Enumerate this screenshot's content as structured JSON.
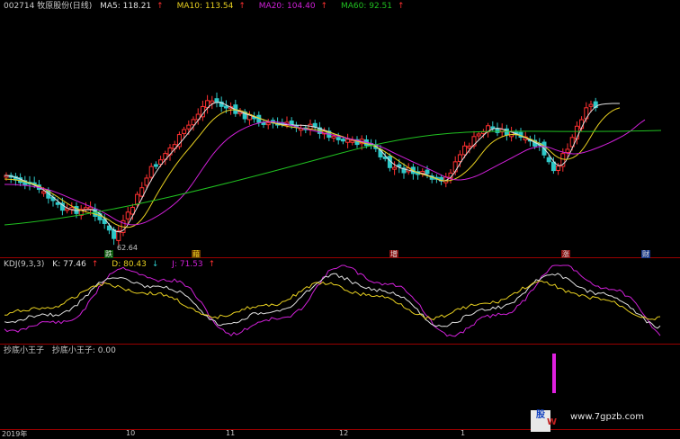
{
  "main": {
    "symbol": "002714 牧原股份(日线)",
    "ma5": {
      "label": "MA5: 118.21",
      "arrow": "↑"
    },
    "ma10": {
      "label": "MA10: 113.54",
      "arrow": "↑"
    },
    "ma20": {
      "label": "MA20: 104.40",
      "arrow": "↑"
    },
    "ma60": {
      "label": "MA60: 92.51",
      "arrow": "↑"
    },
    "low_mark": "62.64",
    "tags": [
      "跌",
      "藉",
      "增",
      "涨",
      "财"
    ]
  },
  "kdj": {
    "name": "KDJ(9,3,3)",
    "k": {
      "label": "K: 77.46",
      "arrow": "↑"
    },
    "d": {
      "label": "D: 80.43",
      "arrow": "↓"
    },
    "j": {
      "label": "J: 71.53",
      "arrow": "↑"
    }
  },
  "signal": {
    "name": "抄底小王子",
    "value": "抄底小王子: 0.00"
  },
  "time_axis": [
    "2019年",
    "10",
    "11",
    "12",
    "1"
  ],
  "watermark": {
    "logo": "股",
    "w": "W",
    "url": "www.7gpzb.com"
  },
  "colors": {
    "up": "#ff3030",
    "down": "#2ec8c8",
    "ma5": "#e0e0e0",
    "ma10": "#e8d020",
    "ma20": "#d020d8",
    "ma60": "#20c020"
  }
}
